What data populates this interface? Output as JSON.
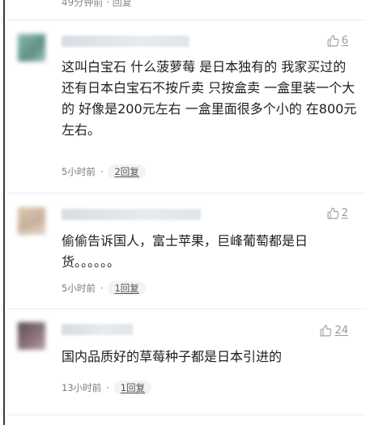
{
  "top_meta": "49分钟前 · 回复",
  "comments": [
    {
      "likes": "6",
      "text": "这叫白宝石 什么菠萝莓 是日本独有的 我家买过的 还有日本白宝石不按斤卖 只按盒卖 一盒里装一个大的 好像是200元左右 一盒里面很多个小的 在800元左右。",
      "time": "5小时前",
      "dot": "·",
      "reply": "2回复"
    },
    {
      "likes": "2",
      "text": "偷偷告诉国人，富士苹果，巨峰葡萄都是日货。。。。。。",
      "time": "5小时前",
      "dot": "·",
      "reply": "1回复"
    },
    {
      "likes": "24",
      "text": "国内品质好的草莓种子都是日本引进的",
      "time": "13小时前",
      "dot": "·",
      "reply": "1回复"
    }
  ],
  "icons": {
    "like": "thumbs-up-icon"
  },
  "colors": {
    "meta": "#7a7a7a",
    "like": "#9a9a9a",
    "reply_bg": "#f3f3f3"
  }
}
